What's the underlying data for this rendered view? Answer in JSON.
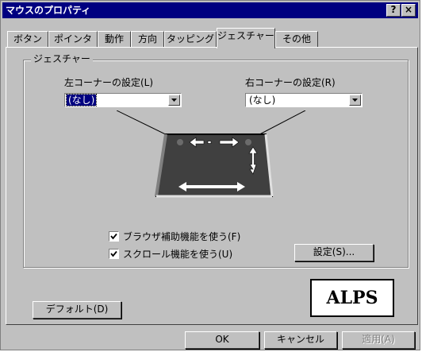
{
  "window": {
    "title": "マウスのプロパティ",
    "help_label": "?",
    "close_label": "×"
  },
  "tabs": [
    {
      "label": "ボタン",
      "active": false
    },
    {
      "label": "ポインタ",
      "active": false
    },
    {
      "label": "動作",
      "active": false
    },
    {
      "label": "方向",
      "active": false
    },
    {
      "label": "タッピング",
      "active": false
    },
    {
      "label": "ジェスチャー",
      "active": true
    },
    {
      "label": "その他",
      "active": false
    }
  ],
  "gesture_group": {
    "label": "ジェスチャー",
    "left_corner": {
      "label": "左コーナーの設定(L)",
      "value": "(なし)",
      "focused": true
    },
    "right_corner": {
      "label": "右コーナーの設定(R)",
      "value": "(なし)",
      "focused": false
    },
    "checkboxes": [
      {
        "label": "ブラウザ補助機能を使う(F)",
        "checked": true
      },
      {
        "label": "スクロール機能を使う(U)",
        "checked": true
      }
    ],
    "settings_button": "設定(S)..."
  },
  "logo": {
    "text": "ALPS"
  },
  "buttons": {
    "default": "デフォルト(D)",
    "ok": "OK",
    "cancel": "キャンセル",
    "apply": "適用(A)"
  },
  "colors": {
    "face": "#c0c0c0",
    "title_bar": "#000080",
    "pad_surface": "#404040",
    "pad_arrow": "#ffffff"
  }
}
